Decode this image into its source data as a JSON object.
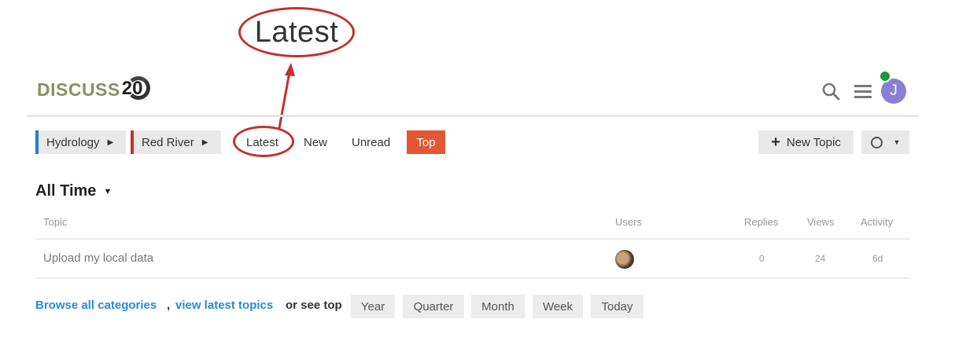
{
  "annotation": {
    "label": "Latest"
  },
  "header": {
    "logo_text": "DISCUSS",
    "logo_number": "20",
    "avatar_initial": "J"
  },
  "nav": {
    "breadcrumbs": [
      {
        "label": "Hydrology",
        "color": "#2a7ccc"
      },
      {
        "label": "Red River",
        "color": "#c0322f"
      }
    ],
    "tabs": [
      "Latest",
      "New",
      "Unread",
      "Top"
    ],
    "active_tab": "Top",
    "new_topic_label": "New Topic"
  },
  "period": {
    "label": "All Time"
  },
  "table": {
    "columns": [
      "Topic",
      "Users",
      "Replies",
      "Views",
      "Activity"
    ],
    "rows": [
      {
        "topic": "Upload my local data",
        "replies": "0",
        "views": "24",
        "activity": "6d"
      }
    ]
  },
  "footer": {
    "browse_label": "Browse all categories",
    "comma": ",",
    "latest_label": "view latest topics",
    "see_top_label": "or see top",
    "periods": [
      "Year",
      "Quarter",
      "Month",
      "Week",
      "Today"
    ]
  },
  "colors": {
    "accent": "#e45735",
    "link": "#2a8bd0",
    "annotation": "#c0322f"
  }
}
